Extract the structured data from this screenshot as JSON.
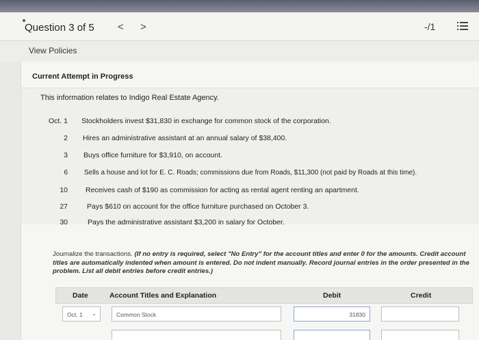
{
  "header": {
    "question_label": "Question 3 of 5",
    "prev_label": "<",
    "next_label": ">",
    "score": "-/1",
    "list_icon": "list-icon"
  },
  "policies_link": "View Policies",
  "attempt_label": "Current Attempt in Progress",
  "intro": "This information relates to Indigo Real Estate Agency.",
  "transactions": [
    {
      "date": "Oct. 1",
      "text": "Stockholders invest $31,830 in exchange for common stock of the corporation."
    },
    {
      "date": "2",
      "text": "Hires an administrative assistant at an annual salary of $38,400."
    },
    {
      "date": "3",
      "text": "Buys office furniture for $3,910, on account."
    },
    {
      "date": "6",
      "text": "Sells a house and lot for E. C. Roads; commissions due from Roads, $11,300 (not paid by Roads at this time)."
    },
    {
      "date": "10",
      "text": "Receives cash of $190 as commission for acting as rental agent renting an apartment."
    },
    {
      "date": "27",
      "text": "Pays $610 on account for the office furniture purchased on October 3."
    },
    {
      "date": "30",
      "text": "Pays the administrative assistant $3,200 in salary for October."
    }
  ],
  "instruction_lead": "Journalize the transactions.",
  "instruction_italic": "(If no entry is required, select \"No Entry\" for the account titles and enter 0 for the amounts. Credit account titles are automatically indented when amount is entered. Do not indent manually. Record journal entries in the order presented in the problem. List all debit entries before credit entries.)",
  "journal": {
    "headers": {
      "date": "Date",
      "account": "Account Titles and Explanation",
      "debit": "Debit",
      "credit": "Credit"
    },
    "row1": {
      "date": "Oct. 1",
      "account": "Common Stock",
      "debit": "31830",
      "credit": ""
    }
  }
}
